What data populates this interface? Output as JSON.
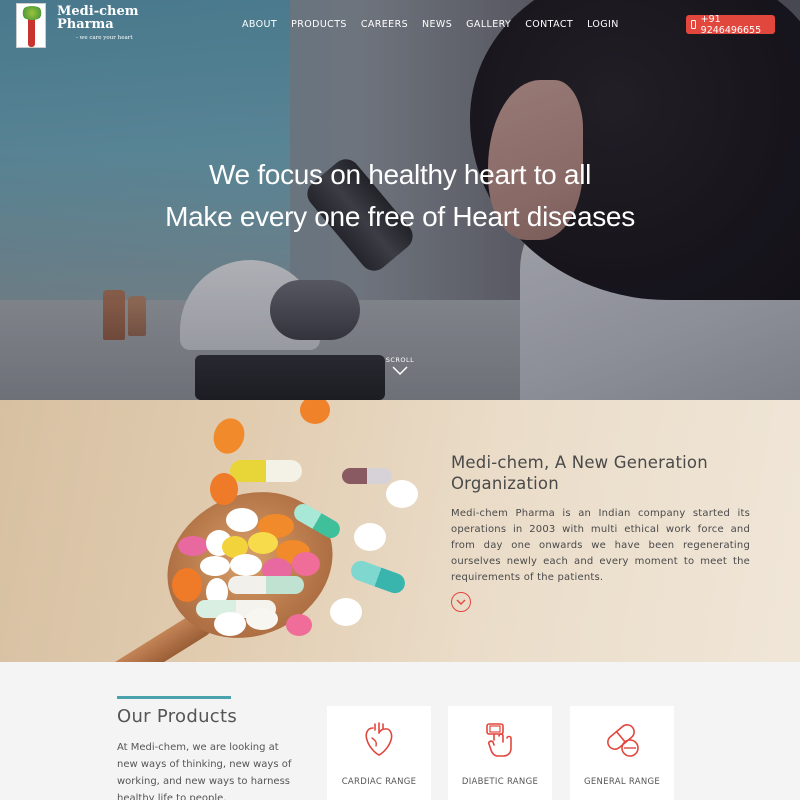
{
  "header": {
    "logo": {
      "name": "Medi-chem Pharma",
      "tagline": "- we care your heart"
    },
    "nav": [
      "ABOUT",
      "PRODUCTS",
      "CAREERS",
      "NEWS",
      "GALLERY",
      "CONTACT",
      "LOGIN"
    ],
    "phone": "+91 9246496655"
  },
  "hero": {
    "line1": "We focus on healthy heart to all",
    "line2": "Make every one free of Heart diseases",
    "scroll_label": "SCROLL"
  },
  "about": {
    "title": "Medi-chem, A New Generation Organization",
    "text": "Medi-chem Pharma is an Indian company started its operations in 2003 with multi ethical work force and from day one onwards we have been regenerating ourselves newly each and every moment to meet the requirements of the patients."
  },
  "products": {
    "title": "Our Products",
    "text": "At Medi-chem, we are looking at new ways of thinking, new ways of working, and new ways to harness healthy life to people.",
    "cards": [
      {
        "label": "CARDIAC RANGE",
        "icon": "heart-icon"
      },
      {
        "label": "DIABETIC RANGE",
        "icon": "glucometer-icon"
      },
      {
        "label": "GENERAL RANGE",
        "icon": "pills-icon"
      }
    ]
  },
  "colors": {
    "accent": "#e2473e",
    "teal": "#4aa3ac"
  }
}
